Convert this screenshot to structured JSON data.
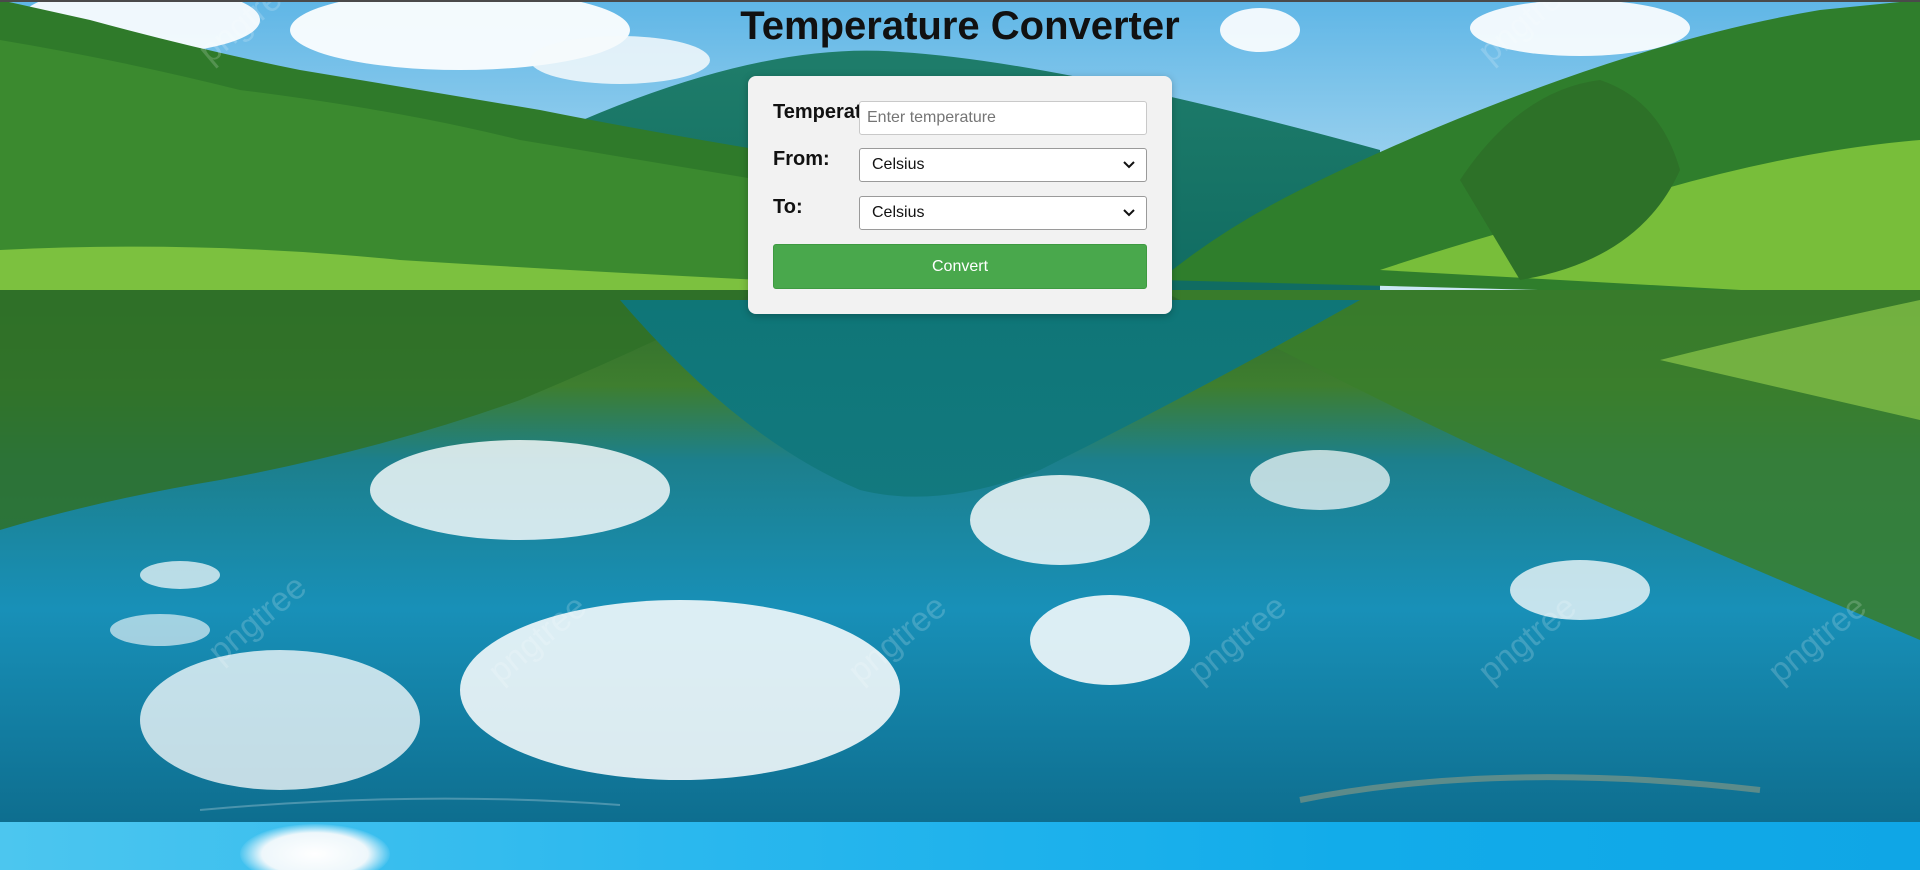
{
  "page": {
    "title": "Temperature Converter"
  },
  "form": {
    "temperature_label": "Temperature:",
    "temperature_placeholder": "Enter temperature",
    "temperature_value": "",
    "from_label": "From:",
    "from_selected": "Celsius",
    "to_label": "To:",
    "to_selected": "Celsius",
    "convert_label": "Convert"
  },
  "background": {
    "watermark_text": "pngtree"
  },
  "colors": {
    "convert_button": "#49a84c",
    "card_background": "#f2f2f2"
  }
}
